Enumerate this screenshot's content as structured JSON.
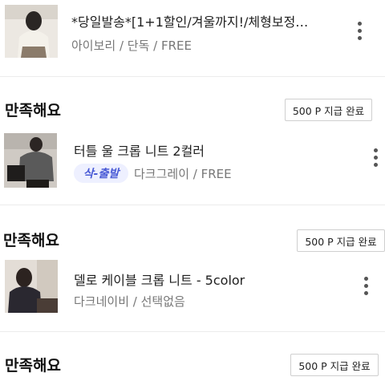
{
  "items": [
    {
      "title": "*당일발송*[1+1할인/겨울까지!/체형보정…",
      "option": "아이보리 / 단독 / FREE"
    },
    {
      "section": "만족해요",
      "reward": "500 P 지급 완료",
      "title": "터틀 울 크롭 니트 2컬러",
      "tag": "삭-출발",
      "option": "다크그레이 / FREE"
    },
    {
      "section": "만족해요",
      "reward": "500 P 지급 완료",
      "title": "델로 케이블 크롭 니트 - 5color",
      "option": "다크네이비 / 선택없음"
    },
    {
      "section": "만족해요",
      "reward": "500 P 지급 완료"
    }
  ],
  "colors": {
    "tag_bg": "#eef0ff",
    "tag_text": "#4a5bd6",
    "divider": "#ececec"
  },
  "icons": {
    "more": "kebab-vertical-icon"
  }
}
